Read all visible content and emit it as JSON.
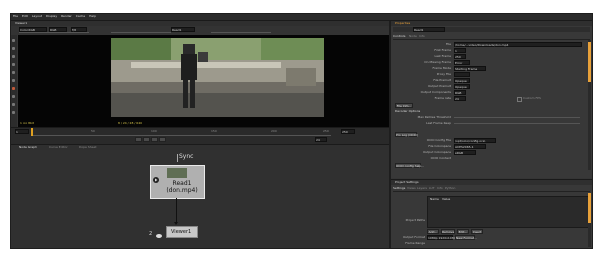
{
  "menubar": [
    "File",
    "Edit",
    "Layout",
    "Display",
    "Render",
    "Cache",
    "Help"
  ],
  "viewer": {
    "tab": "Viewer1",
    "top_fields": [
      "Color.RGB",
      "RGB",
      "f/8",
      "Read1"
    ],
    "frame_start": "1",
    "frame_end": "250",
    "ruler": [
      "1",
      "50",
      "100",
      "150",
      "200",
      "250"
    ],
    "status_left": "1 ico 8bit",
    "status_mid": "8 / 24 / 28 / 640",
    "fps": "24"
  },
  "nodegraph": {
    "tabs": [
      "Node Graph",
      "Curve Editor",
      "Dope Sheet"
    ],
    "sync_label": "Sync",
    "read_node_label": "Read1\n(don.mp4)",
    "viewer_node_label": "Viewer1",
    "input_number": "2"
  },
  "properties": {
    "title": "Properties",
    "node": "Read1",
    "tabs": [
      "Controls",
      "Node",
      "Info"
    ],
    "file": "/home/...video/Downloads/don.mp4",
    "fields": [
      {
        "label": "File",
        "value": ""
      },
      {
        "label": "First Frame",
        "value": "1"
      },
      {
        "label": "Last Frame",
        "value": "250"
      },
      {
        "label": "On Missing Frame",
        "value": "Error"
      },
      {
        "label": "Frame Mode",
        "value": "Starting Frame"
      },
      {
        "label": "Proxy File",
        "value": ""
      },
      {
        "label": "File Premult",
        "value": "Opaque"
      },
      {
        "label": "Output Premult",
        "value": "Opaque"
      },
      {
        "label": "Output Components",
        "value": "RGB"
      },
      {
        "label": "Frame rate",
        "value": "24"
      }
    ],
    "custom_fps": "Custom FPS",
    "file_info": "File Info...",
    "decoder_title": "Decoder Options",
    "decoder_fields": [
      "Max Retries Threshold",
      "Last Frame Keep"
    ],
    "ocio_title": "Pro Log (OCIO)",
    "ocio_fields": [
      {
        "label": "OCIO Config File",
        "value": "/opt/ocio/config.ocio"
      },
      {
        "label": "File Colorspace",
        "value": "ACES2065-1"
      },
      {
        "label": "Output Colorspace",
        "value": "sRGB"
      },
      {
        "label": "OCIO Context",
        "value": ""
      }
    ],
    "ocio_help": "OCIO config help..."
  },
  "project": {
    "title": "Project Settings",
    "tabs": [
      "Settings",
      "Views",
      "Layers",
      "LUT",
      "Info",
      "Python"
    ],
    "paths_label": "Project Paths",
    "table_headers": [
      "Name",
      "Value"
    ],
    "buttons": [
      "Add...",
      "Remove",
      "Edit...",
      "Insert"
    ],
    "output_format_label": "Output Format",
    "output_format_value": "1080p 1920x1080",
    "new_format": "New Format...",
    "frame_range_label": "Frame Range"
  }
}
